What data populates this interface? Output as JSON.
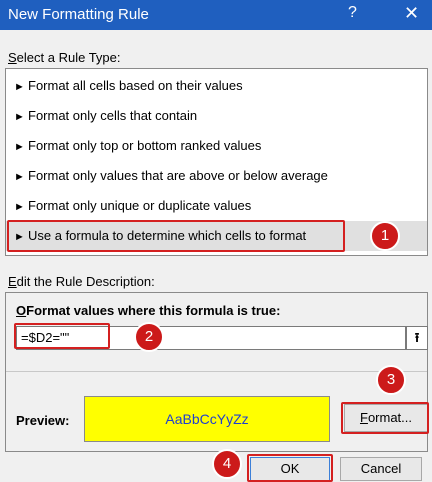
{
  "window": {
    "title": "New Formatting Rule",
    "help_glyph": "?",
    "close_glyph": "✕"
  },
  "rule_type": {
    "label_underlined": "S",
    "label_rest": "elect a Rule Type:",
    "items": [
      {
        "arrow": "►",
        "label": "Format all cells based on their values"
      },
      {
        "arrow": "►",
        "label": "Format only cells that contain"
      },
      {
        "arrow": "►",
        "label": "Format only top or bottom ranked values"
      },
      {
        "arrow": "►",
        "label": "Format only values that are above or below average"
      },
      {
        "arrow": "►",
        "label": "Format only unique or duplicate values"
      },
      {
        "arrow": "►",
        "label": "Use a formula to determine which cells to format"
      }
    ],
    "selected_index": 5
  },
  "description": {
    "label_underlined": "E",
    "label_rest": "dit the Rule Description:",
    "formula_label_underlined": "O",
    "formula_label_rest": "Format values where this formula is true:",
    "formula_value": "=$D2=\"\"",
    "collapse_glyph": "⭱"
  },
  "preview": {
    "label": "Preview:",
    "sample_text": "AaBbCcYyZz",
    "fill_color": "#ffff00",
    "text_color": "#1f3fd0"
  },
  "buttons": {
    "format_underlined": "F",
    "format_rest": "ormat...",
    "ok": "OK",
    "cancel": "Cancel"
  },
  "annotations": {
    "badges": [
      "1",
      "2",
      "3",
      "4"
    ],
    "highlight_color": "#d42020"
  }
}
